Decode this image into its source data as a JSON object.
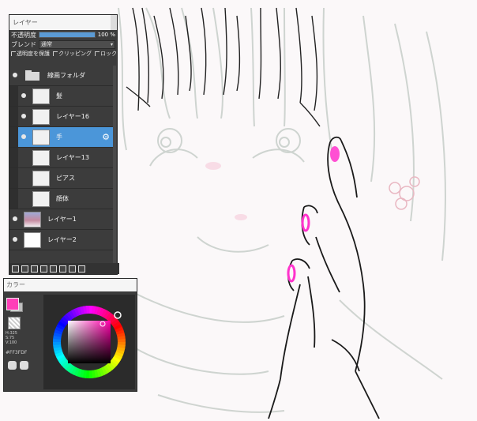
{
  "layer_panel": {
    "title": "レイヤー",
    "opacity_label": "不透明度",
    "opacity_value": "100 %",
    "opacity_fraction": 1.0,
    "blend_label": "ブレンド",
    "blend_value": "通常",
    "protect_alpha_label": "透明度を保護",
    "clipping_label": "クリッピング",
    "lock_label": "ロック",
    "layers": [
      {
        "name": "線画フォルダ",
        "type": "folder",
        "visible": true,
        "selected": false
      },
      {
        "name": "髪",
        "type": "layer",
        "visible": true,
        "selected": false
      },
      {
        "name": "レイヤー16",
        "type": "layer",
        "visible": true,
        "selected": false
      },
      {
        "name": "手",
        "type": "layer",
        "visible": true,
        "selected": true
      },
      {
        "name": "レイヤー13",
        "type": "layer",
        "visible": false,
        "selected": false
      },
      {
        "name": "ピアス",
        "type": "layer",
        "visible": false,
        "selected": false
      },
      {
        "name": "顔体",
        "type": "layer",
        "visible": false,
        "selected": false
      },
      {
        "name": "レイヤー1",
        "type": "layer",
        "visible": true,
        "selected": false
      },
      {
        "name": "レイヤー2",
        "type": "layer",
        "visible": true,
        "selected": false
      }
    ],
    "toolbar_icons": [
      "new-layer-icon",
      "new-layer-copy-icon",
      "new-8bit-layer-icon",
      "merge-down-icon",
      "new-folder-icon",
      "duplicate-icon",
      "layer-settings-icon",
      "delete-layer-icon"
    ]
  },
  "color_panel": {
    "title": "カラー",
    "foreground_color": "#ff3fb8",
    "background_color": "#bfbfbf",
    "hsv_text": "H:325\nS:75\nV:100",
    "hex_text": "#FF3FDF"
  },
  "colors": {
    "panel_bg": "#3c3c3c",
    "selected_row": "#4b96d9",
    "canvas_bg": "#fbf8f9",
    "accent_pink": "#ff33cc"
  }
}
